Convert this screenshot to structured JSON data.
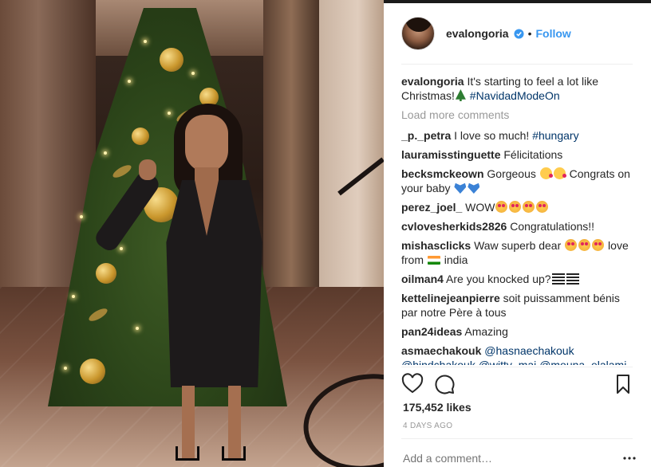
{
  "post": {
    "username": "evalongoria",
    "follow_label": "Follow",
    "separator": "•",
    "photo_alt": "",
    "caption": {
      "username": "evalongoria",
      "text": "It's starting to feel a lot like Christmas!",
      "emoji": "christmas-tree-emoji",
      "hashtag": "#NavidadModeOn"
    },
    "load_more_label": "Load more comments",
    "comments": [
      {
        "username": "_p._petra",
        "text": "I love so much! ",
        "hashtag": "#hungary"
      },
      {
        "username": "lauramisstinguette",
        "text": "Félicitations"
      },
      {
        "username": "becksmckeown",
        "text_before": "Gorgeous",
        "text_after": "Congrats on your baby"
      },
      {
        "username": "perez_joel_",
        "text": "WOW"
      },
      {
        "username": "cvlovesherkids2826",
        "text": "Congratulations!!"
      },
      {
        "username": "mishasclicks",
        "text_before": "Waw superb dear",
        "text_mid": "love from",
        "text_after": "india"
      },
      {
        "username": "oilman4",
        "text": "Are you knocked up?"
      },
      {
        "username": "kettelinejeanpierre",
        "text": "soit puissamment bénis par notre Père à tous"
      },
      {
        "username": "pan24ideas",
        "text": "Amazing"
      },
      {
        "username": "asmaechakouk",
        "mention1": "@hasnaechakouk",
        "mention2": "@hindchakouk @witty_mai @mouna_elalami"
      }
    ],
    "likes": "175,452 likes",
    "time": "4 DAYS AGO",
    "add_comment_placeholder": "Add a comment…"
  },
  "colors": {
    "link_blue": "#3897f0",
    "hashtag": "#003569",
    "muted": "#999999",
    "text": "#262626"
  }
}
